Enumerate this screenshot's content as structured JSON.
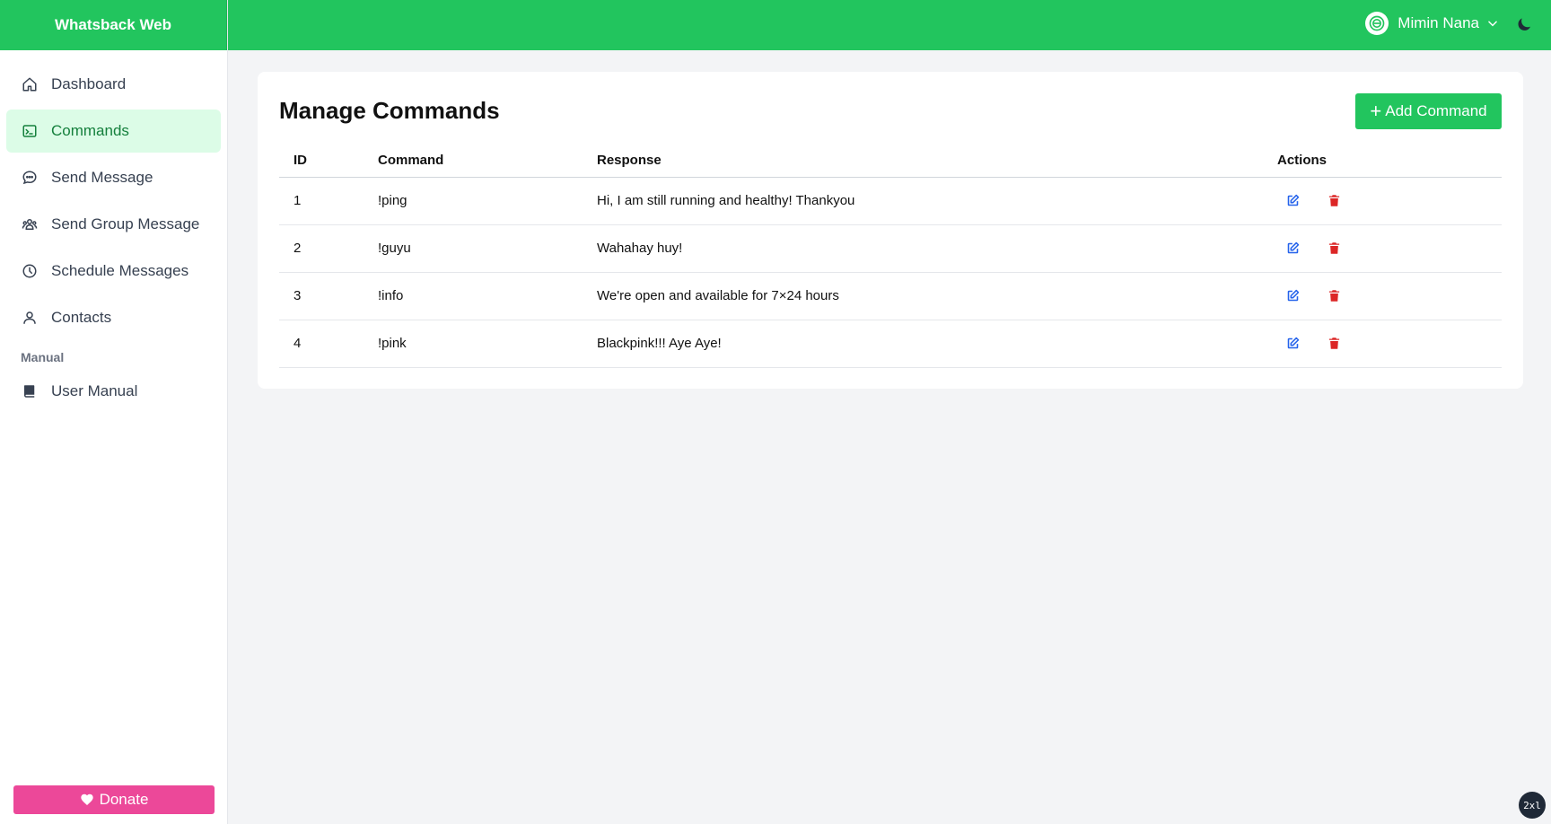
{
  "app": {
    "brand": "Whatsback Web"
  },
  "header": {
    "user_name": "Mimin Nana"
  },
  "sidebar": {
    "items": [
      {
        "label": "Dashboard",
        "icon": "home-icon",
        "active": false
      },
      {
        "label": "Commands",
        "icon": "terminal-icon",
        "active": true
      },
      {
        "label": "Send Message",
        "icon": "chat-icon",
        "active": false
      },
      {
        "label": "Send Group Message",
        "icon": "group-icon",
        "active": false
      },
      {
        "label": "Schedule Messages",
        "icon": "clock-icon",
        "active": false
      },
      {
        "label": "Contacts",
        "icon": "user-icon",
        "active": false
      }
    ],
    "section_label": "Manual",
    "manual_item": {
      "label": "User Manual",
      "icon": "book-icon"
    },
    "donate_label": "Donate"
  },
  "main": {
    "title": "Manage Commands",
    "add_label": "Add Command",
    "table": {
      "headers": [
        "ID",
        "Command",
        "Response",
        "Actions"
      ],
      "rows": [
        {
          "id": "1",
          "command": "!ping",
          "response": "Hi, I am still running and healthy! Thankyou"
        },
        {
          "id": "2",
          "command": "!guyu",
          "response": "Wahahay huy!"
        },
        {
          "id": "3",
          "command": "!info",
          "response": "We're open and available for 7×24 hours"
        },
        {
          "id": "4",
          "command": "!pink",
          "response": "Blackpink!!! Aye Aye!"
        }
      ]
    }
  },
  "badge": "2xl",
  "colors": {
    "accent": "#22c55e",
    "active_bg": "#dcfce7",
    "donate": "#ec4899",
    "edit": "#2563eb",
    "delete": "#dc2626"
  }
}
